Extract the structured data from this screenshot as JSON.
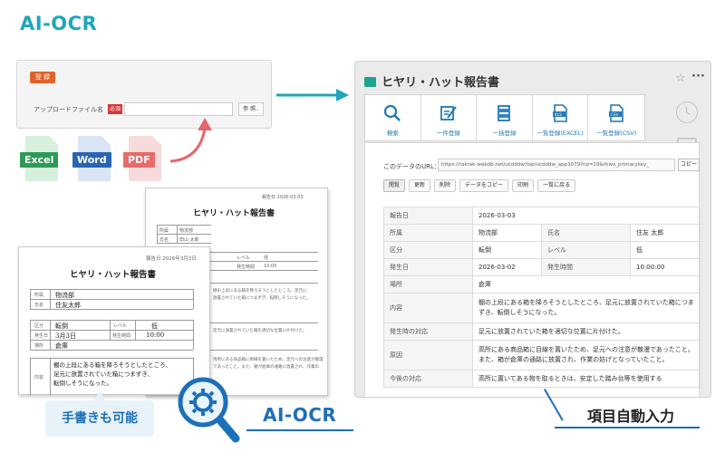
{
  "header": {
    "title": "AI-OCR"
  },
  "upload_panel": {
    "register_label": "登 録",
    "file_label": "アップロードファイル名",
    "required_badge": "必須",
    "browse_label": "参 照.."
  },
  "file_types": [
    {
      "label": "Excel",
      "color": "#2e9a55",
      "page_color": "#d7efdd"
    },
    {
      "label": "Word",
      "color": "#2a64b4",
      "page_color": "#d9e4f5"
    },
    {
      "label": "PDF",
      "color": "#e96a6a",
      "page_color": "#f7dada"
    }
  ],
  "paper_back": {
    "title": "ヒヤリ・ハット報告書",
    "date": "報告日 2026-03-03",
    "rows": [
      {
        "k": "所属",
        "v": "物流部"
      },
      {
        "k": "氏名",
        "v": "田山 太郎"
      },
      {
        "k": "区分",
        "v": "転倒"
      },
      {
        "k": "レベル",
        "v": "低"
      },
      {
        "k": "発生時間",
        "v": "10:00"
      }
    ],
    "body_lines": [
      "棚の上段にある箱を降ろそうとしたところ、足元に",
      "放置されていた箱につまずき、転倒しそうになった。",
      "足元に放置されていた箱を適切な位置に片付けた。",
      "両所にある商品箱に目線を置いたため、足元への注意が散漫",
      "であったこと。また、箱が倉庫の通路に放置され、作業の"
    ]
  },
  "paper_front": {
    "title": "ヒヤリ・ハット報告書",
    "date": "報告日 2026年3月3日",
    "affiliation_label": "所属",
    "affiliation_value": "物流部",
    "name_label": "氏名",
    "name_value": "住友太郎",
    "category_label": "区分",
    "category_value": "転倒",
    "level_label": "レベル",
    "level_value": "低",
    "date_label": "発生日",
    "date_value": "3月3日",
    "time_label": "発生時間",
    "time_value": "10:00",
    "place_label": "場所",
    "place_value": "倉庫",
    "content_label": "内容",
    "content_lines": [
      "棚の上段にある箱を降ろそうとしたところ、",
      "足元に放置されていた箱につまずき、",
      "転倒しそうになった。"
    ]
  },
  "handwriting_badge": "手書きも可能",
  "ocr_label": "AI-OCR",
  "app": {
    "title": "ヒヤリ・ハット報告書",
    "tools": [
      {
        "label": "検索",
        "icon": "search-icon"
      },
      {
        "label": "一件登録",
        "icon": "edit-icon"
      },
      {
        "label": "一括登録",
        "icon": "stack-icon"
      },
      {
        "label": "一覧登録(EXCEL)",
        "icon": "xls-file-icon"
      },
      {
        "label": "一覧登録(CSV)",
        "icon": "csv-file-icon"
      }
    ],
    "url_label": "このデータのURL：",
    "url_value": "https://rakrak-webdb.net/ucdddw/top/ucdddw_app3079?np=19&rkwa_primarykey_",
    "copy_label": "コピー",
    "actions": [
      "閲覧",
      "更新",
      "削除",
      "データをコピー",
      "印刷",
      "一覧に戻る"
    ],
    "record": {
      "report_date_label": "報告日",
      "report_date": "2026-03-03",
      "affiliation_label": "所属",
      "affiliation": "物流部",
      "name_label": "氏名",
      "name": "住友 太郎",
      "category_label": "区分",
      "category": "転倒",
      "level_label": "レベル",
      "level": "低",
      "occurred_date_label": "発生日",
      "occurred_date": "2026-03-02",
      "occurred_time_label": "発生時間",
      "occurred_time": "10:00:00",
      "place_label": "場所",
      "place": "倉庫",
      "content_label": "内容",
      "content": "棚の上段にある箱を降ろそうとしたところ、足元に放置されていた箱につまずき、転倒しそうになった。",
      "response_label": "発生時の対応",
      "response": "足元に放置されていた箱を適切な位置に片付けた。",
      "cause_label": "原因",
      "cause": "高所にある商品箱に目線を置いたため、足元への注意が散漫であったこと。また、箱が倉庫の通路に放置され、作業の妨げとなっていたこと。",
      "future_label": "今後の対応",
      "future": "高所に置いてある物を取るときは、安定した踏み台等を使用する"
    }
  },
  "auto_label": "項目自動入力",
  "colors": {
    "accent_teal": "#1fa6b8",
    "accent_blue": "#1d6fb8",
    "arrow": "#1fa6b8",
    "curve_arrow": "#e8656e"
  }
}
